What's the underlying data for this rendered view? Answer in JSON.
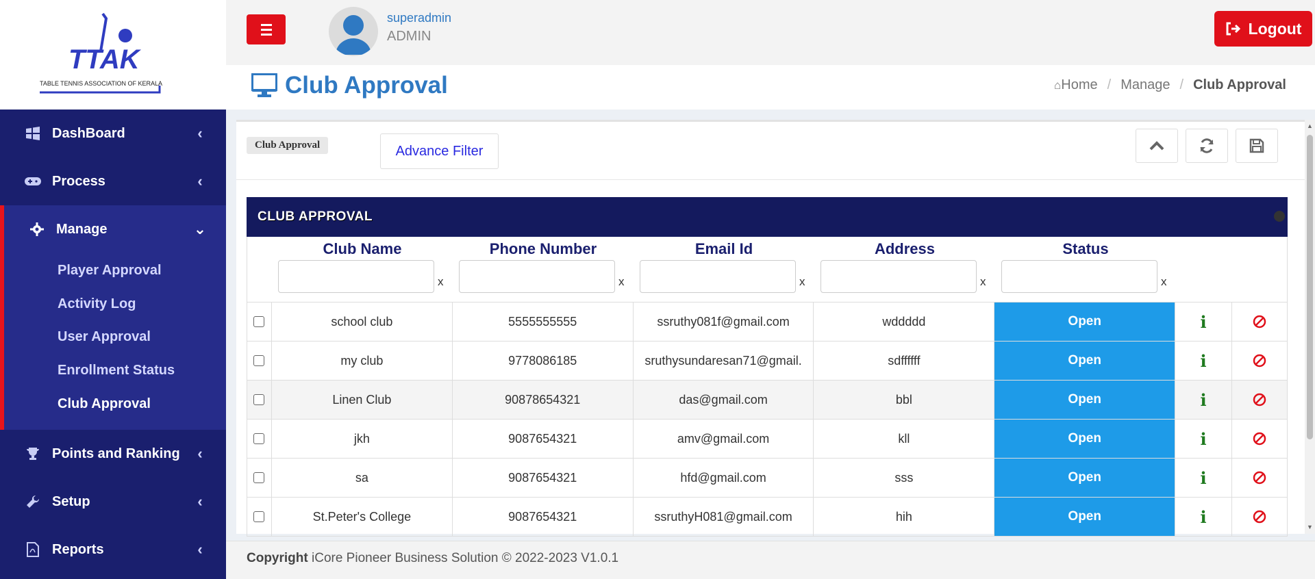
{
  "brand": {
    "logo_text": "TTAK",
    "logo_subtitle": "TABLE TENNIS ASSOCIATION OF KERALA"
  },
  "sidebar": {
    "items": [
      {
        "label": "DashBoard",
        "icon": "windows-icon"
      },
      {
        "label": "Process",
        "icon": "gamepad-icon"
      },
      {
        "label": "Manage",
        "icon": "gear-icon"
      },
      {
        "label": "Points and Ranking",
        "icon": "trophy-icon"
      },
      {
        "label": "Setup",
        "icon": "wrench-icon"
      },
      {
        "label": "Reports",
        "icon": "file-pdf-icon"
      }
    ],
    "manage_sub": [
      {
        "label": "Player Approval"
      },
      {
        "label": "Activity Log"
      },
      {
        "label": "User Approval"
      },
      {
        "label": "Enrollment Status"
      },
      {
        "label": "Club Approval"
      }
    ]
  },
  "topbar": {
    "username": "superadmin",
    "role": "ADMIN",
    "logout_label": "Logout"
  },
  "header": {
    "title": "Club Approval",
    "breadcrumb": [
      "Home",
      "Manage",
      "Club Approval"
    ]
  },
  "toolbar": {
    "tag": "Club Approval",
    "advance_filter": "Advance Filter"
  },
  "table": {
    "title": "CLUB APPROVAL",
    "columns": [
      "Club Name",
      "Phone Number",
      "Email Id",
      "Address",
      "Status"
    ],
    "filter_clear": "x",
    "rows": [
      {
        "name": "school club",
        "phone": "5555555555",
        "email": "ssruthy081f@gmail.com",
        "address": "wddddd",
        "status": "Open"
      },
      {
        "name": "my club",
        "phone": "9778086185",
        "email": "sruthysundaresan71@gmail.",
        "address": "sdffffff",
        "status": "Open"
      },
      {
        "name": "Linen Club",
        "phone": "90878654321",
        "email": "das@gmail.com",
        "address": "bbl",
        "status": "Open"
      },
      {
        "name": "jkh",
        "phone": "9087654321",
        "email": "amv@gmail.com",
        "address": "kll",
        "status": "Open"
      },
      {
        "name": "sa",
        "phone": "9087654321",
        "email": "hfd@gmail.com",
        "address": "sss",
        "status": "Open"
      },
      {
        "name": "St.Peter's College",
        "phone": "9087654321",
        "email": "ssruthyH081@gmail.com",
        "address": "hih",
        "status": "Open"
      }
    ]
  },
  "footer": {
    "copyright_label": "Copyright",
    "text": "iCore Pioneer Business Solution © 2022-2023 V1.0.1"
  },
  "colors": {
    "sidebar_bg": "#1a1f6e",
    "accent_red": "#e0101a",
    "title_blue": "#2f79c2",
    "status_blue": "#1e9be8"
  }
}
